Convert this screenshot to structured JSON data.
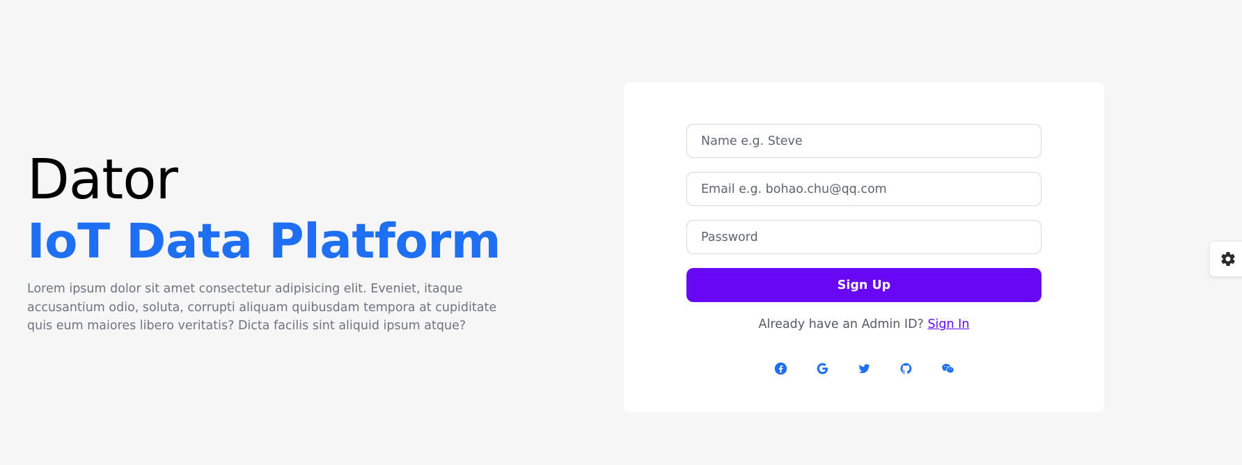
{
  "hero": {
    "brand": "Dator",
    "tagline": "IoT Data Platform",
    "description": "Lorem ipsum dolor sit amet consectetur adipisicing elit. Eveniet, itaque accusantium odio, soluta, corrupti aliquam quibusdam tempora at cupiditate quis eum maiores libero veritatis? Dicta facilis sint aliquid ipsum atque?"
  },
  "form": {
    "name_placeholder": "Name e.g. Steve",
    "name_value": "",
    "email_placeholder": "Email e.g. bohao.chu@qq.com",
    "email_value": "",
    "password_placeholder": "Password",
    "password_value": "",
    "submit_label": "Sign Up",
    "signin_prompt": "Already have an Admin ID?",
    "signin_link": "Sign In"
  },
  "social": [
    {
      "icon": "facebook-icon"
    },
    {
      "icon": "google-icon"
    },
    {
      "icon": "twitter-icon"
    },
    {
      "icon": "github-icon"
    },
    {
      "icon": "wechat-icon"
    }
  ],
  "settings": {
    "icon": "gear-icon"
  },
  "colors": {
    "background": "#f6f6f6",
    "brand_text": "#000000",
    "tagline": "#1f6ff2",
    "description": "#6e7380",
    "primary_button": "#6709f5",
    "social_icons": "#1f6ff2",
    "card": "#ffffff"
  }
}
